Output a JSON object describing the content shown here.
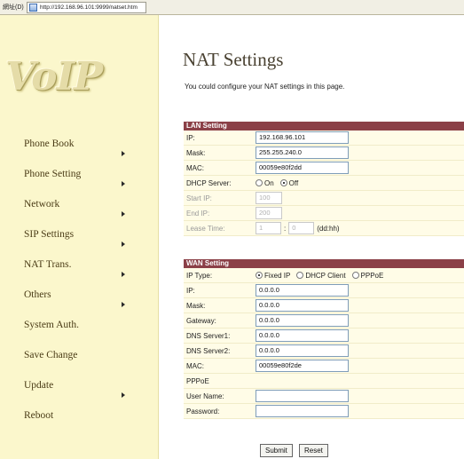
{
  "browser": {
    "address_label": "網址(D)",
    "url": "http://192.168.96.101:9999/natset.htm"
  },
  "logo": {
    "text": "VoIP"
  },
  "sidebar": {
    "items": [
      {
        "label": "Phone Book",
        "arrow": true
      },
      {
        "label": "Phone Setting",
        "arrow": true
      },
      {
        "label": "Network",
        "arrow": true
      },
      {
        "label": "SIP Settings",
        "arrow": true
      },
      {
        "label": "NAT Trans.",
        "arrow": true
      },
      {
        "label": "Others",
        "arrow": true
      },
      {
        "label": "System Auth.",
        "arrow": false
      },
      {
        "label": "Save Change",
        "arrow": false
      },
      {
        "label": "Update",
        "arrow": true
      },
      {
        "label": "Reboot",
        "arrow": false
      }
    ]
  },
  "page": {
    "title": "NAT Settings",
    "subtitle": "You could configure your NAT settings in this page."
  },
  "lan": {
    "heading": "LAN Setting",
    "ip_label": "IP:",
    "ip_value": "192.168.96.101",
    "mask_label": "Mask:",
    "mask_value": "255.255.240.0",
    "mac_label": "MAC:",
    "mac_value": "00059e80f2dd",
    "dhcp_label": "DHCP Server:",
    "dhcp_on": "On",
    "dhcp_off": "Off",
    "dhcp_selected": "Off",
    "start_ip_label": "Start IP:",
    "start_ip_value": "100",
    "end_ip_label": "End IP:",
    "end_ip_value": "200",
    "lease_label": "Lease Time:",
    "lease_days": "1",
    "lease_hours": "0",
    "lease_unit": "(dd:hh)"
  },
  "wan": {
    "heading": "WAN Setting",
    "iptype_label": "IP Type:",
    "iptype_options": [
      "Fixed IP",
      "DHCP Client",
      "PPPoE"
    ],
    "iptype_selected": "Fixed IP",
    "ip_label": "IP:",
    "ip_value": "0.0.0.0",
    "mask_label": "Mask:",
    "mask_value": "0.0.0.0",
    "gateway_label": "Gateway:",
    "gateway_value": "0.0.0.0",
    "dns1_label": "DNS Server1:",
    "dns1_value": "0.0.0.0",
    "dns2_label": "DNS Server2:",
    "dns2_value": "0.0.0.0",
    "mac_label": "MAC:",
    "mac_value": "00059e80f2de",
    "pppoe_label": "PPPoE",
    "user_label": "User Name:",
    "user_value": "",
    "pass_label": "Password:",
    "pass_value": ""
  },
  "buttons": {
    "submit": "Submit",
    "reset": "Reset"
  }
}
